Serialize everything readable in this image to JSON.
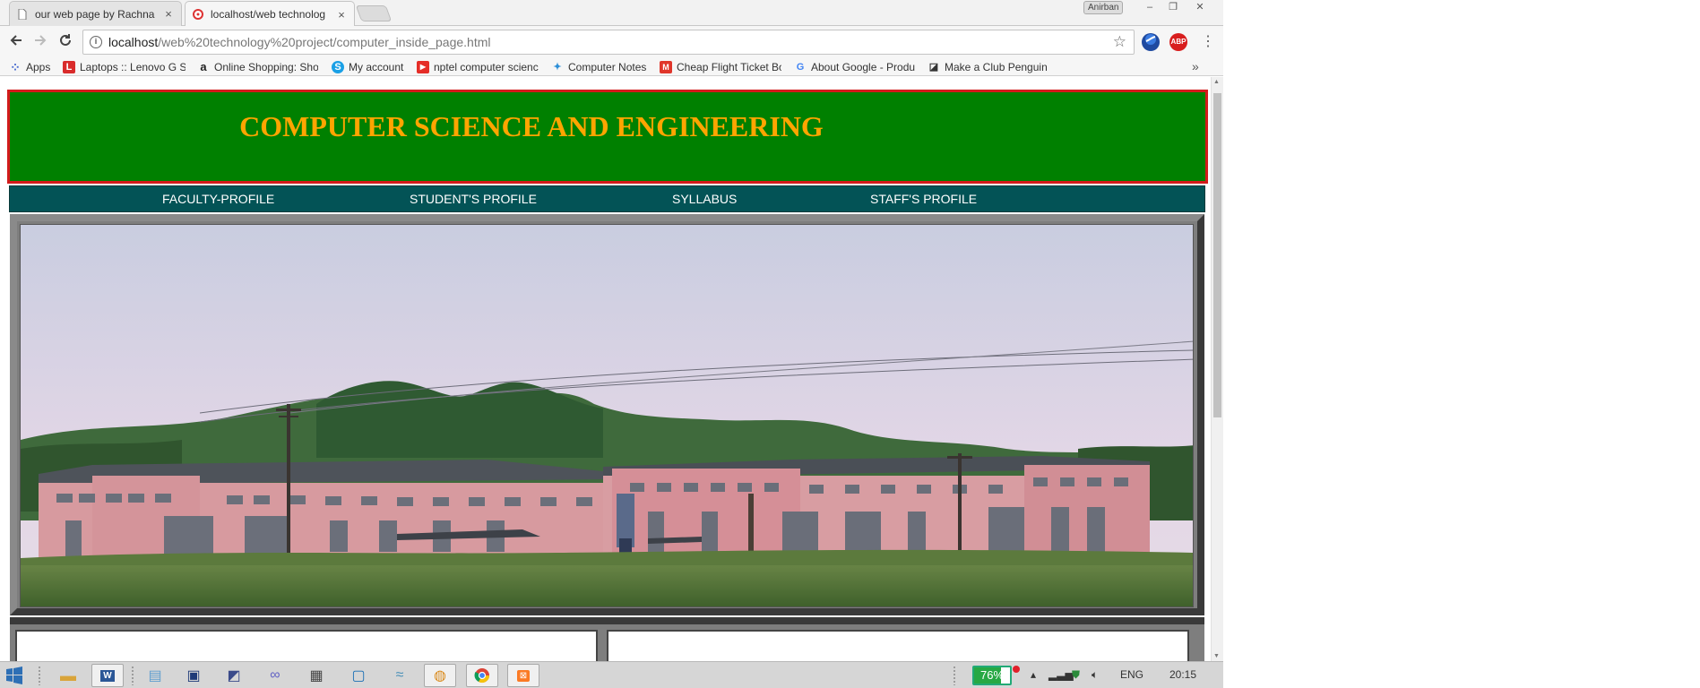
{
  "browser": {
    "tabs": [
      {
        "title": "our web page by Rachna",
        "close": "×"
      },
      {
        "title": "localhost/web technolog",
        "close": "×"
      }
    ],
    "profile_name": "Anirban",
    "window_controls": [
      "–",
      "❐",
      "✕"
    ],
    "address_bar": {
      "host": "localhost",
      "path": "/web%20technology%20project/computer_inside_page.html"
    },
    "extensions": [
      {
        "label": "",
        "color": "#1f4aa0"
      },
      {
        "label": "ABP",
        "color": "#d81e1e"
      }
    ],
    "menu_glyph": "⋮"
  },
  "bookmarks": {
    "items": [
      {
        "label": "Apps",
        "icon": "apps-grid-icon",
        "color": "#4d6fd1",
        "glyph": "⁘"
      },
      {
        "label": "Laptops :: Lenovo G Se",
        "icon": "lenovo-l-icon",
        "color": "#d92b2b",
        "glyph": "L"
      },
      {
        "label": "Online Shopping: Sho",
        "icon": "amazon-a-icon",
        "color": "#222222",
        "glyph": "a"
      },
      {
        "label": "My account",
        "icon": "skype-icon",
        "color": "#1aa0e6",
        "glyph": "S"
      },
      {
        "label": "nptel computer scienc",
        "icon": "youtube-icon",
        "color": "#e52d27",
        "glyph": "▶"
      },
      {
        "label": "Computer Notes",
        "icon": "notes-icon",
        "color": "#2d8fd8",
        "glyph": "✦"
      },
      {
        "label": "Cheap Flight Ticket Bo",
        "icon": "flight-icon",
        "color": "#e0362b",
        "glyph": "M"
      },
      {
        "label": "About Google - Produ",
        "icon": "google-g-icon",
        "color": "#ffffff",
        "glyph": "G"
      },
      {
        "label": "Make a Club Penguin",
        "icon": "penguin-icon",
        "color": "#ffffff",
        "glyph": "◪"
      }
    ],
    "more": "»"
  },
  "page": {
    "header_title": "COMPUTER SCIENCE AND ENGINEERING",
    "nav": [
      "FACULTY-PROFILE",
      "STUDENT'S PROFILE",
      "SYLLABUS",
      "STAFF'S PROFILE"
    ]
  },
  "colors": {
    "header_bg": "#008000",
    "header_border": "#d31b1b",
    "header_text": "#ffa500",
    "nav_bg": "#035356"
  },
  "taskbar": {
    "apps": [
      "start-button",
      "file-explorer",
      "word",
      "notepad",
      "media",
      "presentation",
      "sharing",
      "calculator",
      "settings",
      "network",
      "paint",
      "chrome",
      "xampp"
    ],
    "battery_percent": "76%",
    "battery_level": 0.76,
    "language": "ENG",
    "time": "20:15"
  }
}
